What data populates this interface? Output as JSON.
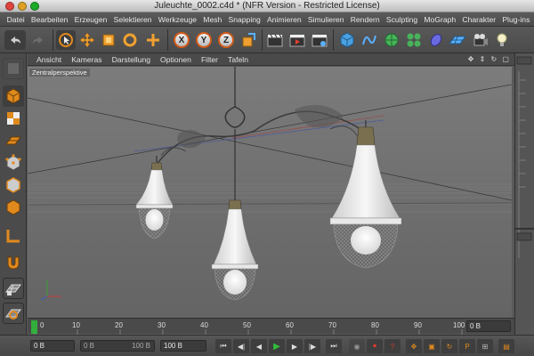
{
  "window": {
    "title": "Juleuchte_0002.c4d * (NFR Version - Restricted License)"
  },
  "menubar": {
    "items": [
      "Datei",
      "Bearbeiten",
      "Erzeugen",
      "Selektieren",
      "Werkzeuge",
      "Mesh",
      "Snapping",
      "Animieren",
      "Simulieren",
      "Rendern",
      "Sculpting",
      "MoGraph",
      "Charakter",
      "Plug-ins"
    ]
  },
  "toolbar": {
    "axis_x": "X",
    "axis_y": "Y",
    "axis_z": "Z"
  },
  "viewport": {
    "menu": [
      "Ansicht",
      "Kameras",
      "Darstellung",
      "Optionen",
      "Filter",
      "Tafeln"
    ],
    "camera_label": "Zentralperspektive",
    "nav_icons": "✥ ⇕ ↻ ▢"
  },
  "timeline": {
    "ticks": [
      "0",
      "10",
      "20",
      "30",
      "40",
      "50",
      "60",
      "70",
      "80",
      "90",
      "100"
    ],
    "current_frame": "0 B"
  },
  "transport": {
    "start_frame": "0 B",
    "range_start": "0 B",
    "range_end": "100 B",
    "end_frame": "100 B"
  },
  "colors": {
    "accent_orange": "#e08a1e",
    "play_green": "#2fbf3a",
    "record_red": "#d83b2a"
  }
}
